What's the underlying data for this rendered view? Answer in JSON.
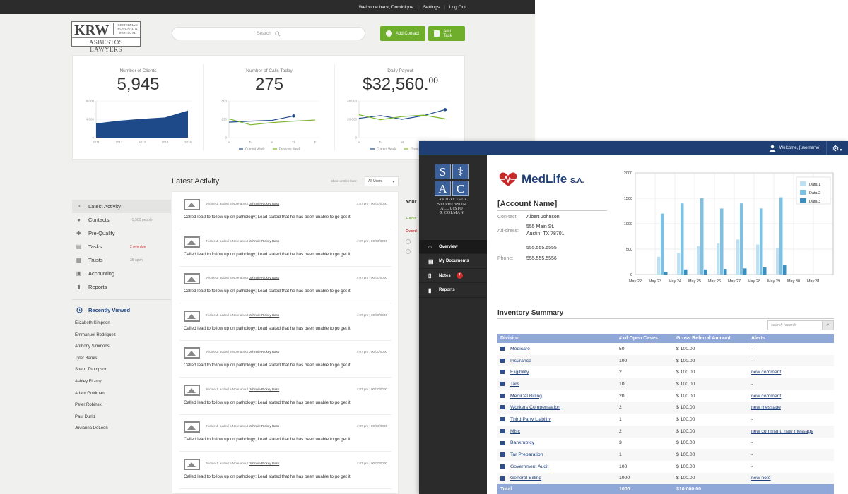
{
  "window_a": {
    "topbar": {
      "welcome": "Welcome back, Dominique",
      "settings": "Settings",
      "logout": "Log Out"
    },
    "logo": {
      "big": "KRW",
      "small_lines": [
        "KETTERMAN",
        "ROWLAND &",
        "WESTLUND"
      ],
      "under": "ASBESTOS LAWYERS"
    },
    "search_placeholder": "Search",
    "buttons": {
      "add_contact": "Add Contact",
      "add_task": "Add Task"
    },
    "stats": [
      {
        "label": "Number of Clients",
        "value": "5,945"
      },
      {
        "label": "Number of Calls Today",
        "value": "275"
      },
      {
        "label": "Daily Payout",
        "value": "$32,560.",
        "cents": "00"
      }
    ],
    "chart_data": [
      {
        "type": "area",
        "x": [
          "2011",
          "2012",
          "2013",
          "2014",
          "2015"
        ],
        "series": [
          {
            "values": [
              3100,
              3700,
              4100,
              4400,
              5900
            ]
          }
        ],
        "y_ticks": [
          "8,000",
          "4,000",
          "0"
        ],
        "ylim": [
          0,
          8000
        ],
        "color": "#1f4a8a"
      },
      {
        "type": "line",
        "x": [
          "M",
          "Tu",
          "W",
          "Th",
          "F"
        ],
        "series": [
          {
            "name": "Current Week",
            "values": [
              210,
              225,
              235,
              295,
              null
            ],
            "color": "#1f4a8a"
          },
          {
            "name": "Previous Week",
            "values": [
              255,
              175,
              205,
              225,
              240
            ],
            "color": "#7cb82f"
          }
        ],
        "y_ticks": [
          "500",
          "250",
          "0"
        ],
        "ylim": [
          0,
          500
        ]
      },
      {
        "type": "line",
        "x": [
          "M",
          "Tu",
          "W",
          "Th",
          "F"
        ],
        "series": [
          {
            "name": "Current Week",
            "values": [
              21000,
              24000,
              20000,
              24000,
              30500
            ],
            "color": "#1f4a8a"
          },
          {
            "name": "Previous Week",
            "values": [
              25000,
              19500,
              23000,
              24500,
              20500
            ],
            "color": "#7cb82f"
          }
        ],
        "y_ticks": [
          "40,000",
          "20,000",
          "0"
        ],
        "ylim": [
          0,
          40000
        ]
      }
    ],
    "activity": {
      "title": "Latest Activity",
      "show_entries": "Show entries from:",
      "filter": "All Users",
      "items": [
        {
          "meta": "Nicole J. added a Note about",
          "who": "Johnnie Rickey Bass",
          "date": "4:07 pm  |  00/00/0000",
          "msg": "Called lead to follow up on pathology; Lead stated that he has been unable to go get it"
        },
        {
          "meta": "Nicole J. added a Note about",
          "who": "Johnnie Rickey Bass",
          "date": "4:07 pm  |  00/00/0000",
          "msg": "Called lead to follow up on pathology; Lead stated that he has been unable to go get it"
        },
        {
          "meta": "Nicole J. added a Note about",
          "who": "Johnnie Rickey Bass",
          "date": "4:07 pm  |  00/00/0000",
          "msg": "Called lead to follow up on pathology; Lead stated that he has been unable to go get it"
        },
        {
          "meta": "Nicole J. added a Note about",
          "who": "Johnnie Rickey Bass",
          "date": "4:07 pm  |  00/00/0000",
          "msg": "Called lead to follow up on pathology; Lead stated that he has been unable to go get it"
        },
        {
          "meta": "Nicole J. added a Note about",
          "who": "Johnnie Rickey Bass",
          "date": "4:07 pm  |  00/00/0000",
          "msg": "Called lead to follow up on pathology; Lead stated that he has been unable to go get it"
        },
        {
          "meta": "Nicole J. added a Note about",
          "who": "Johnnie Rickey Bass",
          "date": "4:07 pm  |  00/00/0000",
          "msg": "Called lead to follow up on pathology; Lead stated that he has been unable to go get it"
        },
        {
          "meta": "Nicole J. added a Note about",
          "who": "Johnnie Rickey Bass",
          "date": "4:07 pm  |  00/00/0000",
          "msg": "Called lead to follow up on pathology; Lead stated that he has been unable to go get it"
        },
        {
          "meta": "Nicole J. added a Note about",
          "who": "Johnnie Rickey Bass",
          "date": "4:07 pm  |  00/00/0000",
          "msg": "Called lead to follow up on pathology; Lead stated that he has been unable to go get it"
        }
      ]
    },
    "sidebar": [
      {
        "label": "Latest Activity",
        "icon": "speedometer-icon",
        "aside": ""
      },
      {
        "label": "Contacts",
        "icon": "person-icon",
        "aside": "~5,500 people"
      },
      {
        "label": "Pre-Qualify",
        "icon": "plus-icon",
        "aside": ""
      },
      {
        "label": "Tasks",
        "icon": "tasks-icon",
        "aside": "2 overdue"
      },
      {
        "label": "Trusts",
        "icon": "trusts-icon",
        "aside": "35 open"
      },
      {
        "label": "Accounting",
        "icon": "calculator-icon",
        "aside": ""
      },
      {
        "label": "Reports",
        "icon": "bar-chart-icon",
        "aside": ""
      }
    ],
    "recent": {
      "title": "Recently Viewed",
      "names": [
        "Elizabeth Simpson",
        "Emmanuel Rodriguez",
        "Anthony Simmons",
        "Tyler Banks",
        "Sherri Thompson",
        "Ashley Fitzroy",
        "Adam Goldman",
        "Peter Robinski",
        "Paul Duritz",
        "Juvianna DeLeon"
      ]
    },
    "rightcol": {
      "title": "Your",
      "add": "+ Add",
      "overdue": "Overd"
    }
  },
  "window_b": {
    "bar": {
      "welcome": "Welcome, [username]"
    },
    "firm": {
      "letters": [
        "S",
        "A",
        "C",
        ""
      ],
      "lines": [
        "LAW OFFICES OF",
        "STEPHENSON",
        "ACQUISTO",
        "& COLMAN"
      ]
    },
    "nav": [
      {
        "label": "Overview",
        "icon": "home-icon"
      },
      {
        "label": "My Documents",
        "icon": "documents-icon"
      },
      {
        "label": "Notes",
        "icon": "notes-icon",
        "badge": "7"
      },
      {
        "label": "Reports",
        "icon": "report-icon"
      }
    ],
    "brand": {
      "name": "MedLife",
      "suffix": "S.A."
    },
    "account": {
      "title": "[Account Name]",
      "contact_key": "Con-tact:",
      "contact": "Albert Johnson",
      "address_key": "Ad-dress:",
      "address_1": "555 Main St.",
      "address_2": "Austin, TX 78701",
      "address_3": "555.555.5555",
      "phone_key": "Phone:",
      "phone": "555.555.5556"
    },
    "chart_data": {
      "type": "bar",
      "categories": [
        "May 22",
        "May 23",
        "May 24",
        "May 25",
        "May 26",
        "May 27",
        "May 28",
        "May 29",
        "May 30",
        "May 31"
      ],
      "series": [
        {
          "name": "Data 1",
          "values": [
            0,
            350,
            430,
            560,
            610,
            690,
            590,
            520,
            0,
            0
          ],
          "color": "#bfe0f0"
        },
        {
          "name": "Data 2",
          "values": [
            0,
            1200,
            1400,
            1500,
            1300,
            1400,
            1300,
            1520,
            0,
            0
          ],
          "color": "#7fc1e2"
        },
        {
          "name": "Data 3",
          "values": [
            0,
            50,
            100,
            100,
            110,
            120,
            140,
            180,
            0,
            0
          ],
          "color": "#3a8fc0"
        }
      ],
      "ylim": [
        0,
        2000
      ],
      "y_ticks": [
        "0",
        "500",
        "1000",
        "1500",
        "2000"
      ],
      "legend": "top-right"
    },
    "inventory": {
      "title": "Inventory Summary",
      "search_placeholder": "search records",
      "columns": [
        "Division",
        "# of Open Cases",
        "Gross Referral Amount",
        "Alerts"
      ],
      "rows": [
        [
          "Medicare",
          "50",
          "$ 100.00",
          "-"
        ],
        [
          "Insurance",
          "100",
          "$ 100.00",
          "-"
        ],
        [
          "Eligibility",
          "2",
          "$ 100.00",
          "new comment"
        ],
        [
          "Tars",
          "10",
          "$ 100.00",
          "-"
        ],
        [
          "MediCal Billing",
          "20",
          "$ 100.00",
          "new comment"
        ],
        [
          "Workers Compensation",
          "2",
          "$ 100.00",
          "new message"
        ],
        [
          "Third Party Liability",
          "1",
          "$ 100.00",
          "-"
        ],
        [
          "Misc",
          "2",
          "$ 100.00",
          "new comment, new message"
        ],
        [
          "Bankruptcy",
          "3",
          "$ 100.00",
          "-"
        ],
        [
          "Tar Preparation",
          "1",
          "$ 100.00",
          "-"
        ],
        [
          "Government Audit",
          "100",
          "$ 100.00",
          "-"
        ],
        [
          "General Billing",
          "1000",
          "$ 100.00",
          "new note"
        ]
      ],
      "total": [
        "Total",
        "1000",
        "$10,000.00",
        ""
      ]
    }
  }
}
